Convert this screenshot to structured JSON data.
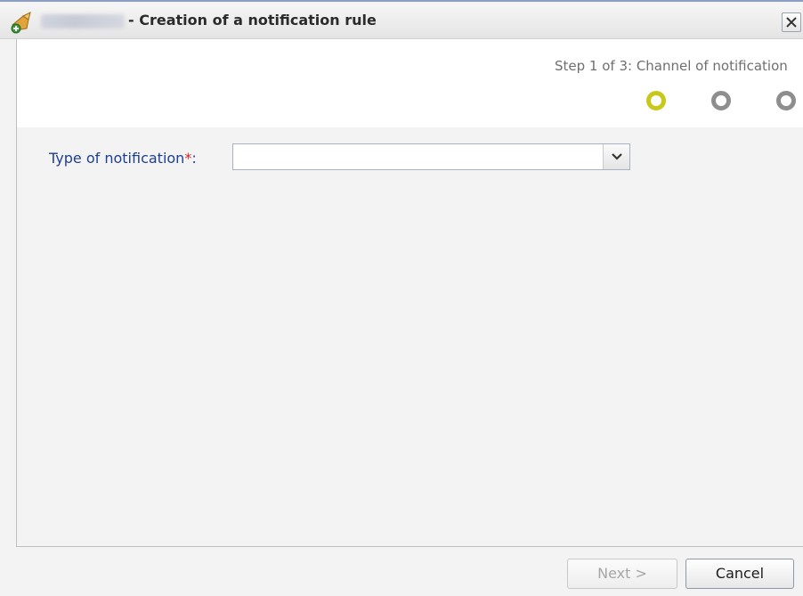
{
  "window": {
    "title": "- Creation of a notification rule",
    "close_label": "X"
  },
  "steps": {
    "text": "Step 1 of 3: Channel of notification",
    "current": 1,
    "total": 3,
    "colors": {
      "active": "#c8c81a",
      "inactive": "#8e8e8e"
    }
  },
  "form": {
    "type_label": "Type of notification",
    "required_marker": "*",
    "label_suffix": ":",
    "type_value": ""
  },
  "buttons": {
    "next": "Next >",
    "cancel": "Cancel"
  },
  "icons": {
    "app": "app-logo-icon",
    "close": "close-icon",
    "dropdown": "chevron-down-icon"
  }
}
